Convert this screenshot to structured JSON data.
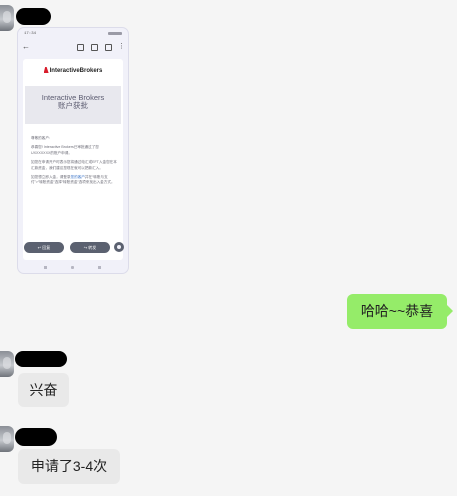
{
  "colors": {
    "self_bubble": "#95ec69",
    "other_bubble": "#e9e9e9",
    "background": "#f5f5f5",
    "brand_red": "#d81c2b"
  },
  "phone_shot": {
    "status_time": "17:34",
    "brand": "InteractiveBrokers",
    "title_line1": "Interactive Brokers",
    "title_line2": "账户获批",
    "greeting": "尊敬的客户:",
    "para1": "恭喜您! Interactive Brokers已审批通过了您UXXXXXXX的账户申请。",
    "para2": "如您在申请开户时表示您将通过电汇或EFT入金您在本汇款资金，我们建议您现在就可以把款汇入。",
    "para3_prefix": "如您想立即入金，请登录",
    "para3_link": "您的客户",
    "para3_suffix": "并在“转账与支付”>“转账资金”选择“转账资金”选项来找出入金方式。",
    "reply_button": "回复",
    "forward_button": "转发",
    "icons": [
      "back-arrow-icon",
      "archive-icon",
      "delete-icon",
      "mail-icon",
      "more-vert-icon",
      "reply-icon",
      "forward-icon",
      "emoji-icon"
    ]
  },
  "messages": [
    {
      "sender": "self",
      "text": "哈哈~~恭喜"
    },
    {
      "sender": "other",
      "text": "兴奋"
    },
    {
      "sender": "other",
      "text": "申请了3-4次"
    }
  ]
}
